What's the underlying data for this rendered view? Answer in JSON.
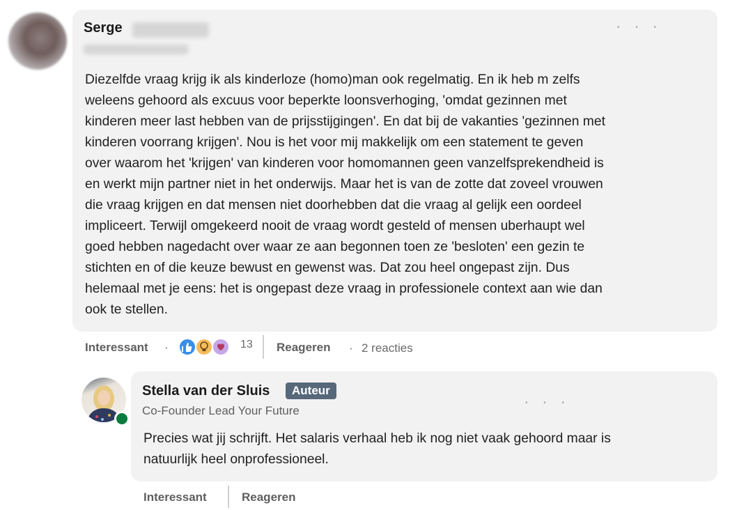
{
  "comment": {
    "author_name": "Serge",
    "body": "Diezelfde vraag krijg ik als kinderloze (homo)man ook regelmatig. En ik heb m zelfs\nweleens gehoord als excuus voor beperkte loonsverhoging, 'omdat gezinnen met\nkinderen meer last hebben van de prijsstijgingen'. En dat bij de vakanties 'gezinnen met\nkinderen voorrang krijgen'. Nou is het voor mij makkelijk om een statement te geven\nover waarom het 'krijgen' van kinderen voor homomannen geen vanzelfsprekendheid is\nen werkt mijn partner niet in het onderwijs. Maar het is van de zotte dat zoveel vrouwen\ndie vraag krijgen en dat mensen niet doorhebben dat die vraag al gelijk een oordeel\nimpliceert. Terwijl omgekeerd nooit de vraag wordt gesteld of mensen uberhaupt wel\ngoed hebben nagedacht over waar ze aan begonnen toen ze 'besloten' een gezin te\nstichten en of die keuze bewust en gewenst was. Dat zou heel ongepast zijn. Dus\nhelemaal met je eens: het is ongepast deze vraag in professionele context aan wie dan\nook te stellen.",
    "reaction_label": "Interessant",
    "reaction_count": "13",
    "reply_label": "Reageren",
    "replies_count": "2 reacties",
    "dot_separator": "·"
  },
  "reply": {
    "author_name": "Stella van der Sluis",
    "author_badge": "Auteur",
    "author_title": "Co-Founder Lead Your Future",
    "body": "Precies wat jij schrijft. Het salaris verhaal heb ik nog niet vaak gehoord maar is\nnatuurlijk heel onprofessioneel.",
    "reaction_label": "Interessant",
    "reply_label": "Reageren"
  },
  "colors": {
    "bubble_bg": "#f2f2f2",
    "badge_bg": "#56687a",
    "online_dot": "#0a7b3e",
    "like_blue": "#378fe9",
    "insight_yellow": "#f5bb5c",
    "support_purple": "#c6a7e8"
  },
  "icons": [
    "like-icon",
    "insightful-icon",
    "support-icon",
    "online-status-icon"
  ]
}
